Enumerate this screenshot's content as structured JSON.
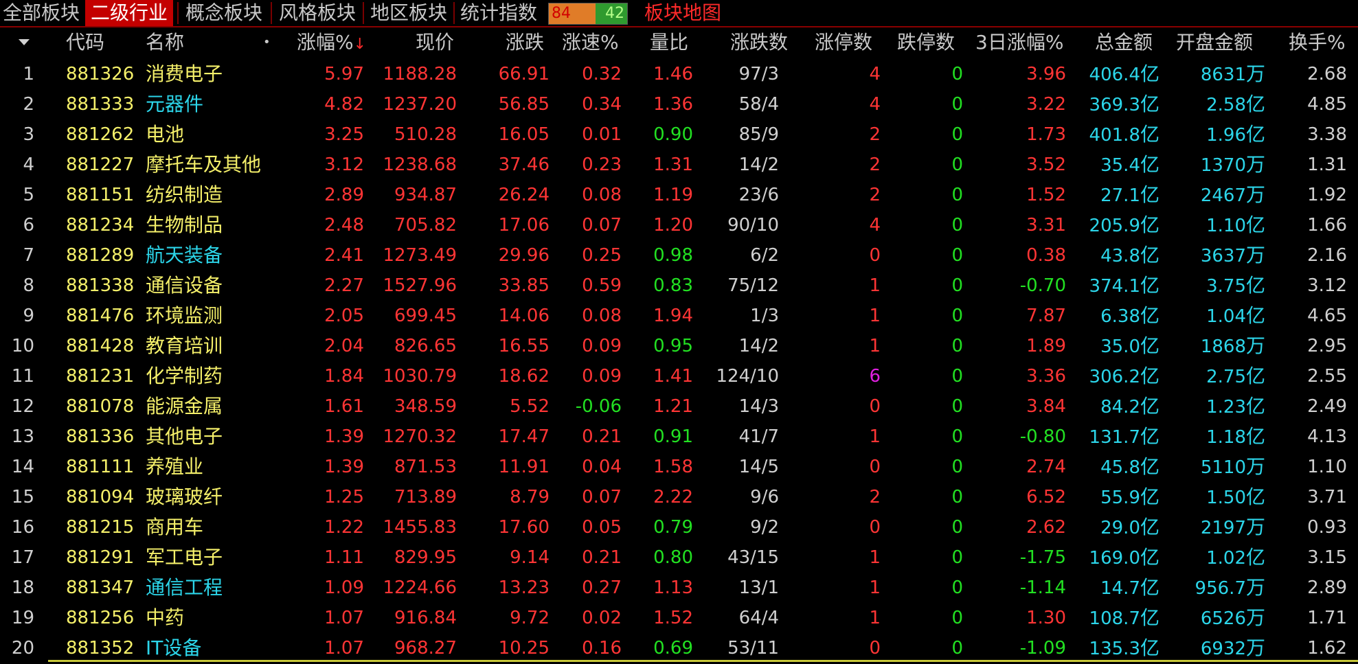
{
  "tabs": [
    {
      "label": "全部板块",
      "active": false
    },
    {
      "label": "二级行业",
      "active": true
    },
    {
      "label": "概念板块",
      "active": false
    },
    {
      "label": "风格板块",
      "active": false
    },
    {
      "label": "地区板块",
      "active": false
    },
    {
      "label": "统计指数",
      "active": false
    }
  ],
  "ratio": {
    "up": "84",
    "down": "42"
  },
  "map_link": "板块地图",
  "colors": {
    "up": "#ff3535",
    "down": "#22e022",
    "flat": "#d0d0d0",
    "code": "#f5f06a",
    "amount": "#2cd6ea",
    "active_tab": "#c40000"
  },
  "headers": {
    "code": "代码",
    "name": "名称",
    "name_dot": "•",
    "pct": "涨幅%",
    "pct_sort": "↓",
    "price": "现价",
    "chg": "涨跌",
    "speed": "涨速%",
    "vol_ratio": "量比",
    "updown": "涨跌数",
    "limit_up": "涨停数",
    "limit_down": "跌停数",
    "three_day": "3日涨幅%",
    "amount": "总金额",
    "open_amount": "开盘金额",
    "turnover": "换手%"
  },
  "rows": [
    {
      "idx": "1",
      "code": "881326",
      "name": "消费电子",
      "name_color": "yellow",
      "pct": "5.97",
      "price": "1188.28",
      "chg": "66.91",
      "speed": "0.32",
      "vr": "1.46",
      "vr_color": "red",
      "ud": "97/3",
      "lu": "4",
      "lu_color": "red",
      "ld": "0",
      "d3": "3.96",
      "d3_color": "red",
      "amt": "406.4",
      "amt_unit": "亿",
      "open": "8631",
      "open_unit": "万",
      "turn": "2.68"
    },
    {
      "idx": "2",
      "code": "881333",
      "name": "元器件",
      "name_color": "cyan",
      "pct": "4.82",
      "price": "1237.20",
      "chg": "56.85",
      "speed": "0.34",
      "vr": "1.36",
      "vr_color": "red",
      "ud": "58/4",
      "lu": "4",
      "lu_color": "red",
      "ld": "0",
      "d3": "3.22",
      "d3_color": "red",
      "amt": "369.3",
      "amt_unit": "亿",
      "open": "2.58",
      "open_unit": "亿",
      "turn": "4.85"
    },
    {
      "idx": "3",
      "code": "881262",
      "name": "电池",
      "name_color": "yellow",
      "pct": "3.25",
      "price": "510.28",
      "chg": "16.05",
      "speed": "0.01",
      "vr": "0.90",
      "vr_color": "green",
      "ud": "85/9",
      "lu": "2",
      "lu_color": "red",
      "ld": "0",
      "d3": "1.73",
      "d3_color": "red",
      "amt": "401.8",
      "amt_unit": "亿",
      "open": "1.96",
      "open_unit": "亿",
      "turn": "3.38"
    },
    {
      "idx": "4",
      "code": "881227",
      "name": "摩托车及其他",
      "name_color": "yellow",
      "pct": "3.12",
      "price": "1238.68",
      "chg": "37.46",
      "speed": "0.23",
      "vr": "1.31",
      "vr_color": "red",
      "ud": "14/2",
      "lu": "2",
      "lu_color": "red",
      "ld": "0",
      "d3": "3.52",
      "d3_color": "red",
      "amt": "35.4",
      "amt_unit": "亿",
      "open": "1370",
      "open_unit": "万",
      "turn": "1.31"
    },
    {
      "idx": "5",
      "code": "881151",
      "name": "纺织制造",
      "name_color": "yellow",
      "pct": "2.89",
      "price": "934.87",
      "chg": "26.24",
      "speed": "0.08",
      "vr": "1.19",
      "vr_color": "red",
      "ud": "23/6",
      "lu": "2",
      "lu_color": "red",
      "ld": "0",
      "d3": "1.52",
      "d3_color": "red",
      "amt": "27.1",
      "amt_unit": "亿",
      "open": "2467",
      "open_unit": "万",
      "turn": "1.92"
    },
    {
      "idx": "6",
      "code": "881234",
      "name": "生物制品",
      "name_color": "yellow",
      "pct": "2.48",
      "price": "705.82",
      "chg": "17.06",
      "speed": "0.07",
      "vr": "1.20",
      "vr_color": "red",
      "ud": "90/10",
      "lu": "4",
      "lu_color": "red",
      "ld": "0",
      "d3": "3.31",
      "d3_color": "red",
      "amt": "205.9",
      "amt_unit": "亿",
      "open": "1.10",
      "open_unit": "亿",
      "turn": "1.66"
    },
    {
      "idx": "7",
      "code": "881289",
      "name": "航天装备",
      "name_color": "cyan",
      "pct": "2.41",
      "price": "1273.49",
      "chg": "29.96",
      "speed": "0.25",
      "vr": "0.98",
      "vr_color": "green",
      "ud": "6/2",
      "lu": "0",
      "lu_color": "red",
      "ld": "0",
      "d3": "0.38",
      "d3_color": "red",
      "amt": "43.8",
      "amt_unit": "亿",
      "open": "3637",
      "open_unit": "万",
      "turn": "2.16"
    },
    {
      "idx": "8",
      "code": "881338",
      "name": "通信设备",
      "name_color": "yellow",
      "pct": "2.27",
      "price": "1527.96",
      "chg": "33.85",
      "speed": "0.59",
      "vr": "0.83",
      "vr_color": "green",
      "ud": "75/12",
      "lu": "1",
      "lu_color": "red",
      "ld": "0",
      "d3": "-0.70",
      "d3_color": "green",
      "amt": "374.1",
      "amt_unit": "亿",
      "open": "3.75",
      "open_unit": "亿",
      "turn": "3.12"
    },
    {
      "idx": "9",
      "code": "881476",
      "name": "环境监测",
      "name_color": "yellow",
      "pct": "2.05",
      "price": "699.45",
      "chg": "14.06",
      "speed": "0.08",
      "vr": "1.94",
      "vr_color": "red",
      "ud": "1/3",
      "lu": "1",
      "lu_color": "red",
      "ld": "0",
      "d3": "7.87",
      "d3_color": "red",
      "amt": "6.38",
      "amt_unit": "亿",
      "open": "1.04",
      "open_unit": "亿",
      "turn": "4.65"
    },
    {
      "idx": "10",
      "code": "881428",
      "name": "教育培训",
      "name_color": "yellow",
      "pct": "2.04",
      "price": "826.65",
      "chg": "16.55",
      "speed": "0.09",
      "vr": "0.95",
      "vr_color": "green",
      "ud": "14/2",
      "lu": "1",
      "lu_color": "red",
      "ld": "0",
      "d3": "1.89",
      "d3_color": "red",
      "amt": "35.0",
      "amt_unit": "亿",
      "open": "1868",
      "open_unit": "万",
      "turn": "2.95"
    },
    {
      "idx": "11",
      "code": "881231",
      "name": "化学制药",
      "name_color": "yellow",
      "pct": "1.84",
      "price": "1030.79",
      "chg": "18.62",
      "speed": "0.09",
      "vr": "1.41",
      "vr_color": "red",
      "ud": "124/10",
      "lu": "6",
      "lu_color": "magenta",
      "ld": "0",
      "d3": "3.36",
      "d3_color": "red",
      "amt": "306.2",
      "amt_unit": "亿",
      "open": "2.75",
      "open_unit": "亿",
      "turn": "2.55"
    },
    {
      "idx": "12",
      "code": "881078",
      "name": "能源金属",
      "name_color": "yellow",
      "pct": "1.61",
      "price": "348.59",
      "chg": "5.52",
      "speed": "-0.06",
      "vr": "1.21",
      "vr_color": "red",
      "ud": "14/3",
      "lu": "0",
      "lu_color": "red",
      "ld": "0",
      "d3": "3.84",
      "d3_color": "red",
      "amt": "84.2",
      "amt_unit": "亿",
      "open": "1.23",
      "open_unit": "亿",
      "turn": "2.49"
    },
    {
      "idx": "13",
      "code": "881336",
      "name": "其他电子",
      "name_color": "yellow",
      "pct": "1.39",
      "price": "1270.32",
      "chg": "17.47",
      "speed": "0.21",
      "vr": "0.91",
      "vr_color": "green",
      "ud": "41/7",
      "lu": "1",
      "lu_color": "red",
      "ld": "0",
      "d3": "-0.80",
      "d3_color": "green",
      "amt": "131.7",
      "amt_unit": "亿",
      "open": "1.18",
      "open_unit": "亿",
      "turn": "4.13"
    },
    {
      "idx": "14",
      "code": "881111",
      "name": "养殖业",
      "name_color": "yellow",
      "pct": "1.39",
      "price": "871.53",
      "chg": "11.91",
      "speed": "0.04",
      "vr": "1.58",
      "vr_color": "red",
      "ud": "14/5",
      "lu": "0",
      "lu_color": "red",
      "ld": "0",
      "d3": "2.74",
      "d3_color": "red",
      "amt": "45.8",
      "amt_unit": "亿",
      "open": "5110",
      "open_unit": "万",
      "turn": "1.10"
    },
    {
      "idx": "15",
      "code": "881094",
      "name": "玻璃玻纤",
      "name_color": "yellow",
      "pct": "1.25",
      "price": "713.89",
      "chg": "8.79",
      "speed": "0.07",
      "vr": "2.22",
      "vr_color": "red",
      "ud": "9/6",
      "lu": "2",
      "lu_color": "red",
      "ld": "0",
      "d3": "6.52",
      "d3_color": "red",
      "amt": "55.9",
      "amt_unit": "亿",
      "open": "1.50",
      "open_unit": "亿",
      "turn": "3.71"
    },
    {
      "idx": "16",
      "code": "881215",
      "name": "商用车",
      "name_color": "yellow",
      "pct": "1.22",
      "price": "1455.83",
      "chg": "17.60",
      "speed": "0.05",
      "vr": "0.79",
      "vr_color": "green",
      "ud": "9/2",
      "lu": "0",
      "lu_color": "red",
      "ld": "0",
      "d3": "2.62",
      "d3_color": "red",
      "amt": "29.0",
      "amt_unit": "亿",
      "open": "2197",
      "open_unit": "万",
      "turn": "0.93"
    },
    {
      "idx": "17",
      "code": "881291",
      "name": "军工电子",
      "name_color": "yellow",
      "pct": "1.11",
      "price": "829.95",
      "chg": "9.14",
      "speed": "0.21",
      "vr": "0.80",
      "vr_color": "green",
      "ud": "43/15",
      "lu": "1",
      "lu_color": "red",
      "ld": "0",
      "d3": "-1.75",
      "d3_color": "green",
      "amt": "169.0",
      "amt_unit": "亿",
      "open": "1.02",
      "open_unit": "亿",
      "turn": "3.15"
    },
    {
      "idx": "18",
      "code": "881347",
      "name": "通信工程",
      "name_color": "cyan",
      "pct": "1.09",
      "price": "1224.66",
      "chg": "13.23",
      "speed": "0.27",
      "vr": "1.13",
      "vr_color": "red",
      "ud": "13/1",
      "lu": "1",
      "lu_color": "red",
      "ld": "0",
      "d3": "-1.14",
      "d3_color": "green",
      "amt": "14.7",
      "amt_unit": "亿",
      "open": "956.7",
      "open_unit": "万",
      "turn": "2.89"
    },
    {
      "idx": "19",
      "code": "881256",
      "name": "中药",
      "name_color": "yellow",
      "pct": "1.07",
      "price": "916.84",
      "chg": "9.72",
      "speed": "0.02",
      "vr": "1.52",
      "vr_color": "red",
      "ud": "64/4",
      "lu": "1",
      "lu_color": "red",
      "ld": "0",
      "d3": "1.30",
      "d3_color": "red",
      "amt": "108.7",
      "amt_unit": "亿",
      "open": "6526",
      "open_unit": "万",
      "turn": "1.71"
    },
    {
      "idx": "20",
      "code": "881352",
      "name": "IT设备",
      "name_color": "cyan",
      "pct": "1.07",
      "price": "968.27",
      "chg": "10.25",
      "speed": "0.16",
      "vr": "0.69",
      "vr_color": "green",
      "ud": "53/11",
      "lu": "0",
      "lu_color": "red",
      "ld": "0",
      "d3": "-1.09",
      "d3_color": "green",
      "amt": "135.3",
      "amt_unit": "亿",
      "open": "6932",
      "open_unit": "万",
      "turn": "1.62"
    }
  ]
}
